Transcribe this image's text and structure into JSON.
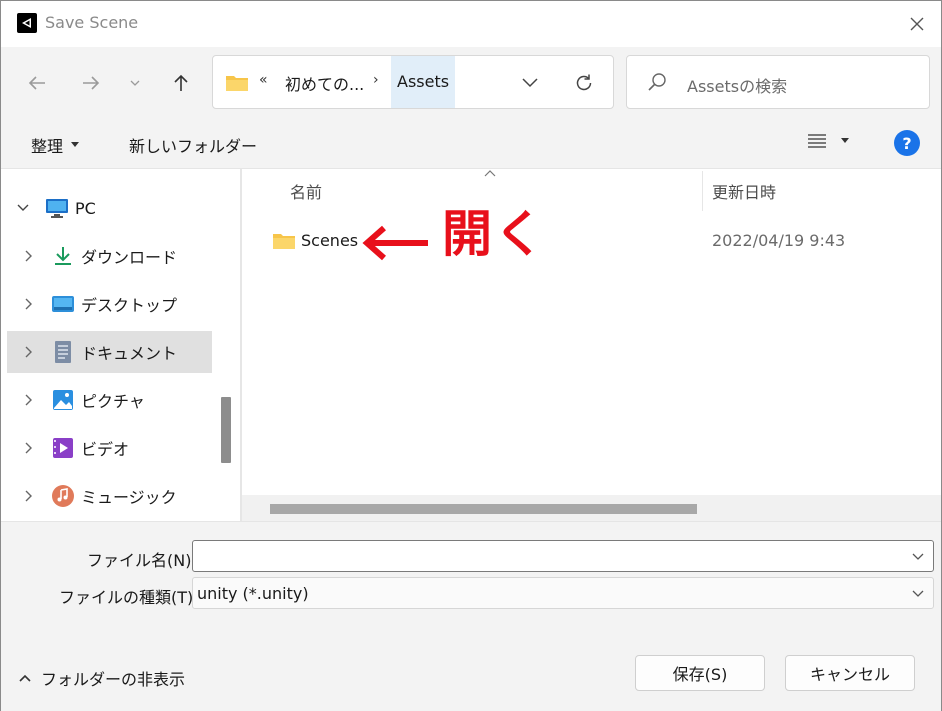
{
  "window": {
    "title": "Save Scene"
  },
  "navigation": {
    "address_prefix": "«",
    "breadcrumbs": [
      "初めての...",
      "Assets"
    ],
    "search_placeholder": "Assetsの検索"
  },
  "toolbar": {
    "organize_label": "整理",
    "new_folder_label": "新しいフォルダー"
  },
  "sidebar": {
    "items": [
      {
        "label": "PC",
        "icon": "pc-icon"
      },
      {
        "label": "ダウンロード",
        "icon": "download-icon"
      },
      {
        "label": "デスクトップ",
        "icon": "desktop-icon"
      },
      {
        "label": "ドキュメント",
        "icon": "documents-icon",
        "selected": true
      },
      {
        "label": "ピクチャ",
        "icon": "pictures-icon"
      },
      {
        "label": "ビデオ",
        "icon": "videos-icon"
      },
      {
        "label": "ミュージック",
        "icon": "music-icon"
      }
    ]
  },
  "file_list": {
    "columns": {
      "name": "名前",
      "date": "更新日時"
    },
    "rows": [
      {
        "name": "Scenes",
        "date": "2022/04/19 9:43",
        "type": "folder"
      }
    ],
    "annotation": {
      "text": "開く",
      "color": "#e8101b"
    }
  },
  "footer": {
    "filename_label": "ファイル名(N):",
    "filename_value": "",
    "filetype_label": "ファイルの種類(T):",
    "filetype_value": "unity (*.unity)",
    "hide_folders_label": "フォルダーの非表示",
    "save_label": "保存(S)",
    "cancel_label": "キャンセル"
  },
  "colors": {
    "accent": "#1a73e8",
    "selection": "#e0e0e0",
    "breadcrumb_highlight": "#e1eef9"
  }
}
